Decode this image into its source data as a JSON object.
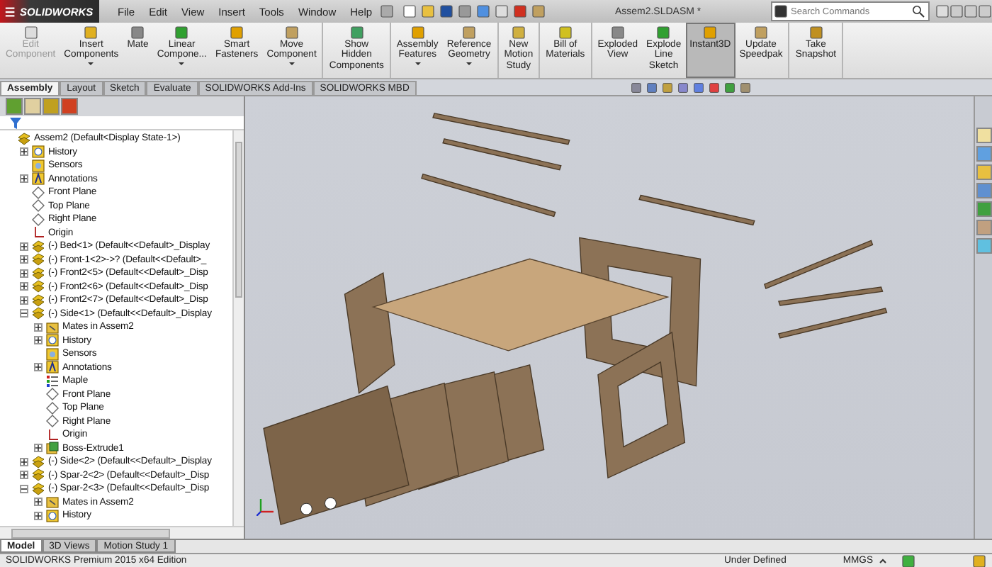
{
  "app": {
    "logo": "SOLIDWORKS",
    "menu": [
      "File",
      "Edit",
      "View",
      "Insert",
      "Tools",
      "Window",
      "Help"
    ],
    "document_title": "Assem2.SLDASM *",
    "search": {
      "placeholder": "Search Commands"
    }
  },
  "command_groups": [
    [
      {
        "label": "Edit\nComponent",
        "disabled": true,
        "dropdown": false,
        "selected": false
      },
      {
        "label": "Insert\nComponents",
        "disabled": false,
        "dropdown": true,
        "selected": false
      },
      {
        "label": "Mate",
        "disabled": false,
        "dropdown": false,
        "selected": false
      },
      {
        "label": "Linear\nCompone...",
        "disabled": false,
        "dropdown": true,
        "selected": false
      },
      {
        "label": "Smart\nFasteners",
        "disabled": false,
        "dropdown": false,
        "selected": false
      },
      {
        "label": "Move\nComponent",
        "disabled": false,
        "dropdown": true,
        "selected": false
      }
    ],
    [
      {
        "label": "Show\nHidden\nComponents",
        "disabled": false,
        "dropdown": false,
        "selected": false
      }
    ],
    [
      {
        "label": "Assembly\nFeatures",
        "disabled": false,
        "dropdown": true,
        "selected": false
      },
      {
        "label": "Reference\nGeometry",
        "disabled": false,
        "dropdown": true,
        "selected": false
      }
    ],
    [
      {
        "label": "New\nMotion\nStudy",
        "disabled": false,
        "dropdown": false,
        "selected": false
      }
    ],
    [
      {
        "label": "Bill of\nMaterials",
        "disabled": false,
        "dropdown": false,
        "selected": false
      }
    ],
    [
      {
        "label": "Exploded\nView",
        "disabled": false,
        "dropdown": false,
        "selected": false
      },
      {
        "label": "Explode\nLine\nSketch",
        "disabled": false,
        "dropdown": false,
        "selected": false
      },
      {
        "label": "Instant3D",
        "disabled": false,
        "dropdown": false,
        "selected": true
      },
      {
        "label": "Update\nSpeedpak",
        "disabled": false,
        "dropdown": false,
        "selected": false
      }
    ],
    [
      {
        "label": "Take\nSnapshot",
        "disabled": false,
        "dropdown": false,
        "selected": false
      }
    ]
  ],
  "tabs": [
    {
      "label": "Assembly",
      "selected": true
    },
    {
      "label": "Layout",
      "selected": false
    },
    {
      "label": "Sketch",
      "selected": false
    },
    {
      "label": "Evaluate",
      "selected": false
    },
    {
      "label": "SOLIDWORKS Add-Ins",
      "selected": false
    },
    {
      "label": "SOLIDWORKS MBD",
      "selected": false
    }
  ],
  "feature_tree": {
    "root": {
      "label": "Assem2  (Default<Display State-1>)",
      "kind": "assembly",
      "children": [
        {
          "label": "History",
          "kind": "history",
          "expanded": false
        },
        {
          "label": "Sensors",
          "kind": "sensor"
        },
        {
          "label": "Annotations",
          "kind": "annotation",
          "expanded": false
        },
        {
          "label": "Front Plane",
          "kind": "plane"
        },
        {
          "label": "Top Plane",
          "kind": "plane"
        },
        {
          "label": "Right Plane",
          "kind": "plane"
        },
        {
          "label": "Origin",
          "kind": "origin"
        },
        {
          "label": "(-) Bed<1> (Default<<Default>_Display",
          "kind": "part",
          "expanded": false
        },
        {
          "label": "(-) Front-1<2>->? (Default<<Default>_",
          "kind": "part",
          "expanded": false
        },
        {
          "label": "(-) Front2<5> (Default<<Default>_Disp",
          "kind": "part",
          "expanded": false
        },
        {
          "label": "(-) Front2<6> (Default<<Default>_Disp",
          "kind": "part",
          "expanded": false
        },
        {
          "label": "(-) Front2<7> (Default<<Default>_Disp",
          "kind": "part",
          "expanded": false
        },
        {
          "label": "(-) Side<1> (Default<<Default>_Display",
          "kind": "part",
          "expanded": true,
          "children": [
            {
              "label": "Mates in Assem2",
              "kind": "mates",
              "expanded": false
            },
            {
              "label": "History",
              "kind": "history",
              "expanded": false
            },
            {
              "label": "Sensors",
              "kind": "sensor"
            },
            {
              "label": "Annotations",
              "kind": "annotation",
              "expanded": false
            },
            {
              "label": "Maple",
              "kind": "material"
            },
            {
              "label": "Front Plane",
              "kind": "plane"
            },
            {
              "label": "Top Plane",
              "kind": "plane"
            },
            {
              "label": "Right Plane",
              "kind": "plane"
            },
            {
              "label": "Origin",
              "kind": "origin"
            },
            {
              "label": "Boss-Extrude1",
              "kind": "feature",
              "expanded": false
            }
          ]
        },
        {
          "label": "(-) Side<2> (Default<<Default>_Display",
          "kind": "part",
          "expanded": false
        },
        {
          "label": "(-) Spar-2<2> (Default<<Default>_Disp",
          "kind": "part",
          "expanded": false
        },
        {
          "label": "(-) Spar-2<3> (Default<<Default>_Disp",
          "kind": "part",
          "expanded": true,
          "children": [
            {
              "label": "Mates in Assem2",
              "kind": "mates",
              "expanded": false
            },
            {
              "label": "History",
              "kind": "history",
              "expanded": false
            }
          ]
        }
      ]
    }
  },
  "bottom_tabs": [
    {
      "label": "Model",
      "selected": true
    },
    {
      "label": "3D Views",
      "selected": false
    },
    {
      "label": "Motion Study 1",
      "selected": false
    }
  ],
  "status_bar": {
    "edition": "SOLIDWORKS Premium 2015 x64 Edition",
    "state": "Under Defined",
    "units": "MMGS"
  }
}
